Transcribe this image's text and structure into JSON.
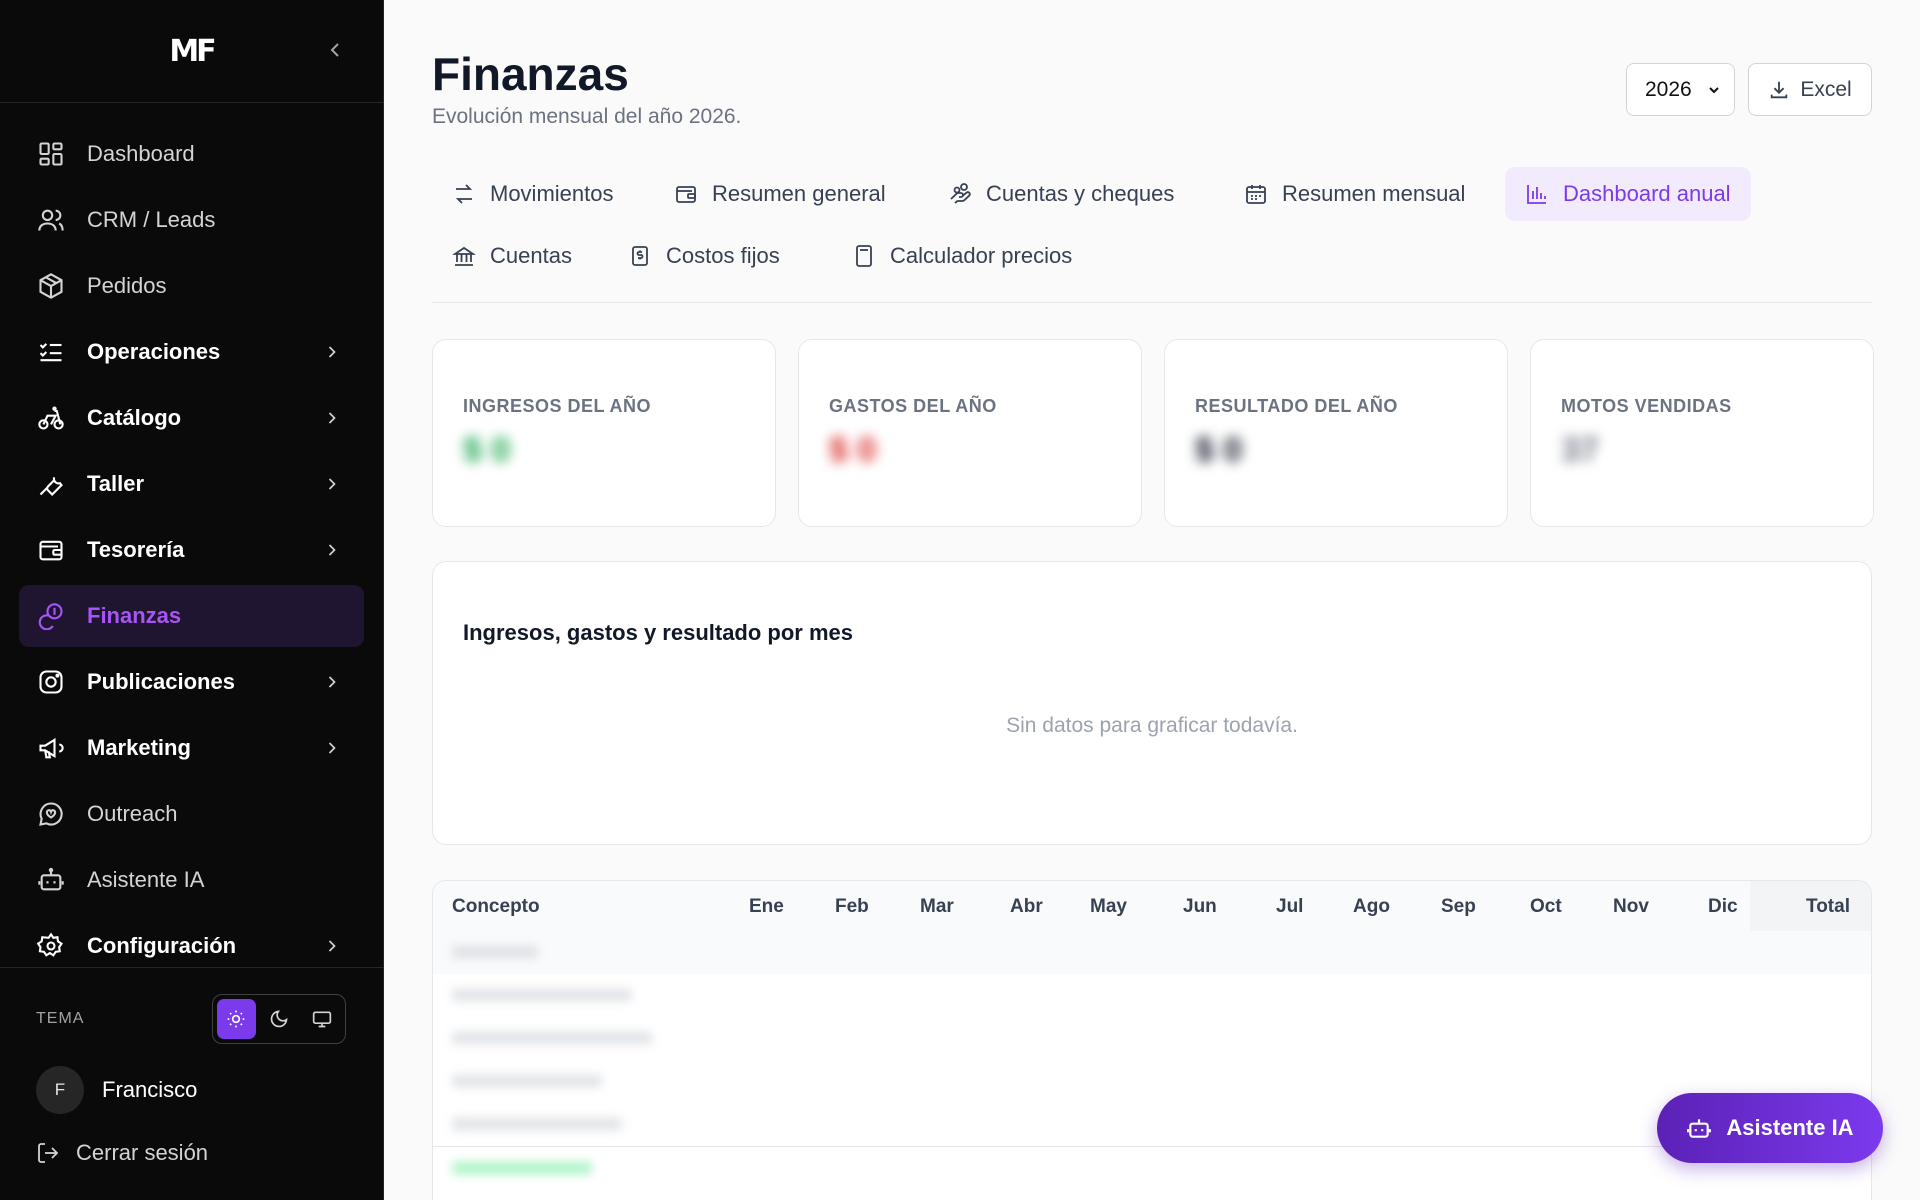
{
  "sidebar": {
    "logo": "MF",
    "items": [
      {
        "label": "Dashboard"
      },
      {
        "label": "CRM / Leads"
      },
      {
        "label": "Pedidos"
      },
      {
        "label": "Operaciones"
      },
      {
        "label": "Catálogo"
      },
      {
        "label": "Taller"
      },
      {
        "label": "Tesorería"
      },
      {
        "label": "Finanzas"
      },
      {
        "label": "Publicaciones"
      },
      {
        "label": "Marketing"
      },
      {
        "label": "Outreach"
      },
      {
        "label": "Asistente IA"
      },
      {
        "label": "Configuración"
      }
    ],
    "theme_label": "TEMA",
    "user_initial": "F",
    "user_name": "Francisco",
    "logout_label": "Cerrar sesión"
  },
  "header": {
    "title": "Finanzas",
    "subtitle": "Evolución mensual del año 2026.",
    "year": "2026",
    "excel_label": "Excel"
  },
  "tabs": [
    {
      "label": "Movimientos"
    },
    {
      "label": "Resumen general"
    },
    {
      "label": "Cuentas y cheques"
    },
    {
      "label": "Resumen mensual"
    },
    {
      "label": "Dashboard anual"
    },
    {
      "label": "Cuentas"
    },
    {
      "label": "Costos fijos"
    },
    {
      "label": "Calculador precios"
    }
  ],
  "kpis": [
    {
      "label": "INGRESOS DEL AÑO",
      "value": "$ 0",
      "color": "#16a34a"
    },
    {
      "label": "GASTOS DEL AÑO",
      "value": "$ 0",
      "color": "#dc2626"
    },
    {
      "label": "RESULTADO DEL AÑO",
      "value": "$ 0",
      "color": "#111827"
    },
    {
      "label": "MOTOS VENDIDAS",
      "value": "37",
      "color": "#6b7280"
    }
  ],
  "chart": {
    "title": "Ingresos, gastos y resultado por mes",
    "empty": "Sin datos para graficar todavía."
  },
  "table": {
    "headers": [
      "Concepto",
      "Ene",
      "Feb",
      "Mar",
      "Abr",
      "May",
      "Jun",
      "Jul",
      "Ago",
      "Sep",
      "Oct",
      "Nov",
      "Dic",
      "Total"
    ]
  },
  "fab": {
    "label": "Asistente IA"
  },
  "colors": {
    "accent": "#7c3aed",
    "sidebar_bg": "#0a0a0a"
  }
}
